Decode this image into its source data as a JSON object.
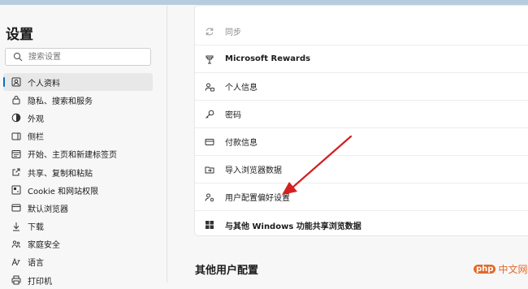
{
  "sidebar": {
    "title": "设置",
    "search_placeholder": "搜索设置",
    "items": [
      {
        "label": "个人资料",
        "icon": "profile-icon",
        "active": true
      },
      {
        "label": "隐私、搜索和服务",
        "icon": "lock-icon"
      },
      {
        "label": "外观",
        "icon": "appearance-icon"
      },
      {
        "label": "侧栏",
        "icon": "sidebar-icon"
      },
      {
        "label": "开始、主页和新建标签页",
        "icon": "home-icon"
      },
      {
        "label": "共享、复制和粘贴",
        "icon": "share-icon"
      },
      {
        "label": "Cookie 和网站权限",
        "icon": "site-permissions-icon"
      },
      {
        "label": "默认浏览器",
        "icon": "browser-icon"
      },
      {
        "label": "下载",
        "icon": "download-icon"
      },
      {
        "label": "家庭安全",
        "icon": "family-icon"
      },
      {
        "label": "语言",
        "icon": "language-icon"
      },
      {
        "label": "打印机",
        "icon": "printer-icon"
      }
    ]
  },
  "main": {
    "rows": [
      {
        "label": "同步",
        "icon": "sync-icon",
        "dim": true
      },
      {
        "label": "Microsoft Rewards",
        "icon": "rewards-icon"
      },
      {
        "label": "个人信息",
        "icon": "personal-info-icon"
      },
      {
        "label": "密码",
        "icon": "key-icon"
      },
      {
        "label": "付款信息",
        "icon": "card-icon"
      },
      {
        "label": "导入浏览器数据",
        "icon": "import-icon"
      },
      {
        "label": "用户配置偏好设置",
        "icon": "profile-settings-icon"
      },
      {
        "label": "与其他 Windows 功能共享浏览数据",
        "icon": "windows-icon"
      }
    ],
    "section_title": "其他用户配置"
  },
  "watermark": {
    "badge": "php",
    "text": "中文网"
  },
  "colors": {
    "accent": "#0f6cbd",
    "arrow": "#d42020",
    "topbar": "#b6cde0"
  }
}
